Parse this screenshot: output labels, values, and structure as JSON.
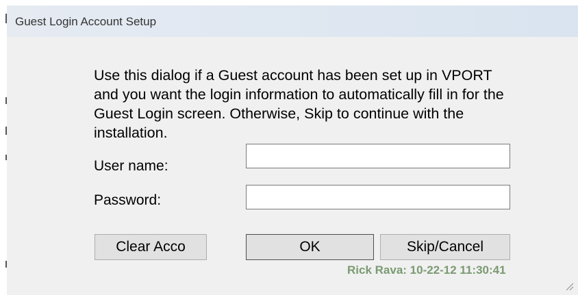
{
  "window": {
    "title": "Guest Login Account Setup"
  },
  "description": "Use this dialog if a Guest account has been set up in VPORT and you want the login information to automatically fill in for the Guest Login screen. Otherwise, Skip to continue with the installation.",
  "form": {
    "username_label": "User name:",
    "username_value": "",
    "password_label": "Password:",
    "password_value": ""
  },
  "buttons": {
    "clear_label": "Clear Acco",
    "ok_label": "OK",
    "skip_label": "Skip/Cancel"
  },
  "watermark": "Rick Rava: 10-22-12 11:30:41",
  "colors": {
    "watermark": "#7a9a72",
    "titlebar": "#e2e9f1",
    "dialog_bg": "#f0f0f0"
  },
  "icons": {
    "resize_grip": "resize-grip-icon"
  }
}
